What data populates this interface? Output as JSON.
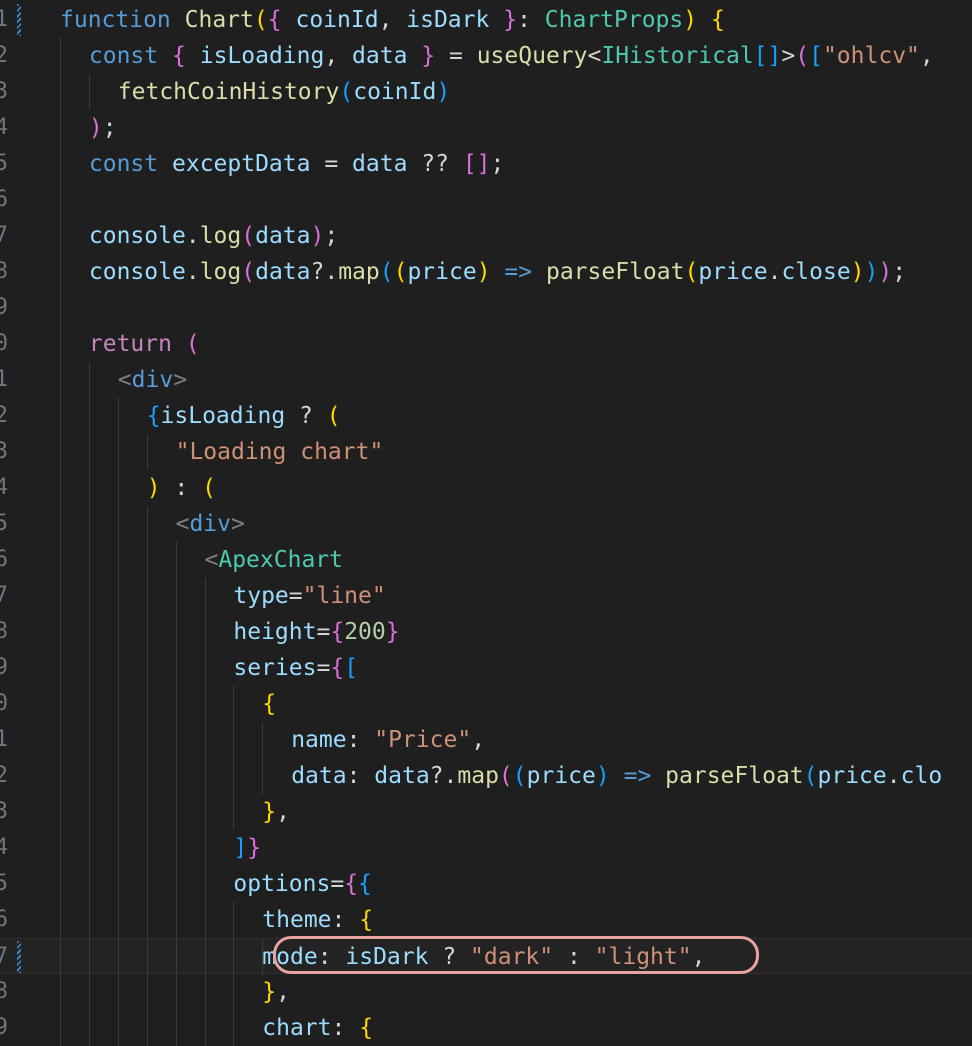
{
  "editor": {
    "gutter": [
      "1",
      "2",
      "3",
      "4",
      "5",
      "6",
      "7",
      "8",
      "9",
      "0",
      "1",
      "2",
      "3",
      "4",
      "5",
      "6",
      "7",
      "8",
      "9",
      "0",
      "1",
      "2",
      "3",
      "4",
      "5",
      "6",
      "7",
      "8",
      "9"
    ],
    "colors": {
      "background": "#1f1f1f",
      "highlight_outline": "#e7a4a0"
    },
    "lines": [
      [
        [
          "t-kw",
          "function"
        ],
        [
          "t-op",
          " "
        ],
        [
          "t-fn",
          "Chart"
        ],
        [
          "b1",
          "("
        ],
        [
          "b2",
          "{"
        ],
        [
          "t-op",
          " "
        ],
        [
          "t-var",
          "coinId"
        ],
        [
          "t-op",
          ", "
        ],
        [
          "t-var",
          "isDark"
        ],
        [
          "t-op",
          " "
        ],
        [
          "b2",
          "}"
        ],
        [
          "t-op",
          ": "
        ],
        [
          "t-type",
          "ChartProps"
        ],
        [
          "b1",
          ")"
        ],
        [
          "t-op",
          " "
        ],
        [
          "b1",
          "{"
        ]
      ],
      [
        [
          "t-kw",
          "const"
        ],
        [
          "t-op",
          " "
        ],
        [
          "b2",
          "{"
        ],
        [
          "t-op",
          " "
        ],
        [
          "t-var",
          "isLoading"
        ],
        [
          "t-op",
          ", "
        ],
        [
          "t-var",
          "data"
        ],
        [
          "t-op",
          " "
        ],
        [
          "b2",
          "}"
        ],
        [
          "t-op",
          " = "
        ],
        [
          "t-fn",
          "useQuery"
        ],
        [
          "t-op",
          "<"
        ],
        [
          "t-type",
          "IHistorical"
        ],
        [
          "b3",
          "[]"
        ],
        [
          "t-op",
          ">"
        ],
        [
          "b2",
          "("
        ],
        [
          "b3",
          "["
        ],
        [
          "t-str",
          "\"ohlcv\""
        ],
        [
          "t-op",
          ","
        ]
      ],
      [
        [
          "t-fn",
          "fetchCoinHistory"
        ],
        [
          "b3",
          "("
        ],
        [
          "t-var",
          "coinId"
        ],
        [
          "b3",
          ")"
        ]
      ],
      [
        [
          "b2",
          ")"
        ],
        [
          "t-op",
          ";"
        ]
      ],
      [
        [
          "t-kw",
          "const"
        ],
        [
          "t-op",
          " "
        ],
        [
          "t-var",
          "exceptData"
        ],
        [
          "t-op",
          " = "
        ],
        [
          "t-var",
          "data"
        ],
        [
          "t-op",
          " ?? "
        ],
        [
          "b2",
          "[]"
        ],
        [
          "t-op",
          ";"
        ]
      ],
      [],
      [
        [
          "t-var",
          "console"
        ],
        [
          "t-op",
          "."
        ],
        [
          "t-fn",
          "log"
        ],
        [
          "b2",
          "("
        ],
        [
          "t-var",
          "data"
        ],
        [
          "b2",
          ")"
        ],
        [
          "t-op",
          ";"
        ]
      ],
      [
        [
          "t-var",
          "console"
        ],
        [
          "t-op",
          "."
        ],
        [
          "t-fn",
          "log"
        ],
        [
          "b2",
          "("
        ],
        [
          "t-var",
          "data"
        ],
        [
          "t-op",
          "?."
        ],
        [
          "t-fn",
          "map"
        ],
        [
          "b3",
          "("
        ],
        [
          "b1",
          "("
        ],
        [
          "t-var",
          "price"
        ],
        [
          "b1",
          ")"
        ],
        [
          "t-op",
          " "
        ],
        [
          "t-kw",
          "=>"
        ],
        [
          "t-op",
          " "
        ],
        [
          "t-fn",
          "parseFloat"
        ],
        [
          "b1",
          "("
        ],
        [
          "t-var",
          "price"
        ],
        [
          "t-op",
          "."
        ],
        [
          "t-var",
          "close"
        ],
        [
          "b1",
          ")"
        ],
        [
          "b3",
          ")"
        ],
        [
          "b2",
          ")"
        ],
        [
          "t-op",
          ";"
        ]
      ],
      [],
      [
        [
          "t-ctl",
          "return"
        ],
        [
          "t-op",
          " "
        ],
        [
          "b2",
          "("
        ]
      ],
      [
        [
          "t-tagbr",
          "<"
        ],
        [
          "t-tag",
          "div"
        ],
        [
          "t-tagbr",
          ">"
        ]
      ],
      [
        [
          "b3",
          "{"
        ],
        [
          "t-var",
          "isLoading"
        ],
        [
          "t-op",
          " ? "
        ],
        [
          "b1",
          "("
        ]
      ],
      [
        [
          "t-str",
          "\"Loading chart\""
        ]
      ],
      [
        [
          "b1",
          ")"
        ],
        [
          "t-op",
          " : "
        ],
        [
          "b1",
          "("
        ]
      ],
      [
        [
          "t-tagbr",
          "<"
        ],
        [
          "t-tag",
          "div"
        ],
        [
          "t-tagbr",
          ">"
        ]
      ],
      [
        [
          "t-tagbr",
          "<"
        ],
        [
          "t-comp",
          "ApexChart"
        ]
      ],
      [
        [
          "t-attr",
          "type"
        ],
        [
          "t-op",
          "="
        ],
        [
          "t-str",
          "\"line\""
        ]
      ],
      [
        [
          "t-attr",
          "height"
        ],
        [
          "t-op",
          "="
        ],
        [
          "b2",
          "{"
        ],
        [
          "t-num",
          "200"
        ],
        [
          "b2",
          "}"
        ]
      ],
      [
        [
          "t-attr",
          "series"
        ],
        [
          "t-op",
          "="
        ],
        [
          "b2",
          "{"
        ],
        [
          "b3",
          "["
        ]
      ],
      [
        [
          "b1",
          "{"
        ]
      ],
      [
        [
          "t-var",
          "name"
        ],
        [
          "t-op",
          ": "
        ],
        [
          "t-str",
          "\"Price\""
        ],
        [
          "t-op",
          ","
        ]
      ],
      [
        [
          "t-var",
          "data"
        ],
        [
          "t-op",
          ": "
        ],
        [
          "t-var",
          "data"
        ],
        [
          "t-op",
          "?."
        ],
        [
          "t-fn",
          "map"
        ],
        [
          "b2",
          "("
        ],
        [
          "b3",
          "("
        ],
        [
          "t-var",
          "price"
        ],
        [
          "b3",
          ")"
        ],
        [
          "t-op",
          " "
        ],
        [
          "t-kw",
          "=>"
        ],
        [
          "t-op",
          " "
        ],
        [
          "t-fn",
          "parseFloat"
        ],
        [
          "b3",
          "("
        ],
        [
          "t-var",
          "price"
        ],
        [
          "t-op",
          "."
        ],
        [
          "t-var",
          "clo"
        ]
      ],
      [
        [
          "b1",
          "}"
        ],
        [
          "t-op",
          ","
        ]
      ],
      [
        [
          "b3",
          "]"
        ],
        [
          "b2",
          "}"
        ]
      ],
      [
        [
          "t-attr",
          "options"
        ],
        [
          "t-op",
          "="
        ],
        [
          "b2",
          "{"
        ],
        [
          "b3",
          "{"
        ]
      ],
      [
        [
          "t-var",
          "theme"
        ],
        [
          "t-op",
          ": "
        ],
        [
          "b1",
          "{"
        ]
      ],
      [
        [
          "t-var",
          "mode"
        ],
        [
          "t-op",
          ": "
        ],
        [
          "t-var",
          "isDark"
        ],
        [
          "t-op",
          " ? "
        ],
        [
          "t-str",
          "\"dark\""
        ],
        [
          "t-op",
          " : "
        ],
        [
          "t-str",
          "\"light\""
        ],
        [
          "t-op",
          ","
        ]
      ],
      [
        [
          "b1",
          "}"
        ],
        [
          "t-op",
          ","
        ]
      ],
      [
        [
          "t-var",
          "chart"
        ],
        [
          "t-op",
          ": "
        ],
        [
          "b1",
          "{"
        ]
      ]
    ]
  }
}
